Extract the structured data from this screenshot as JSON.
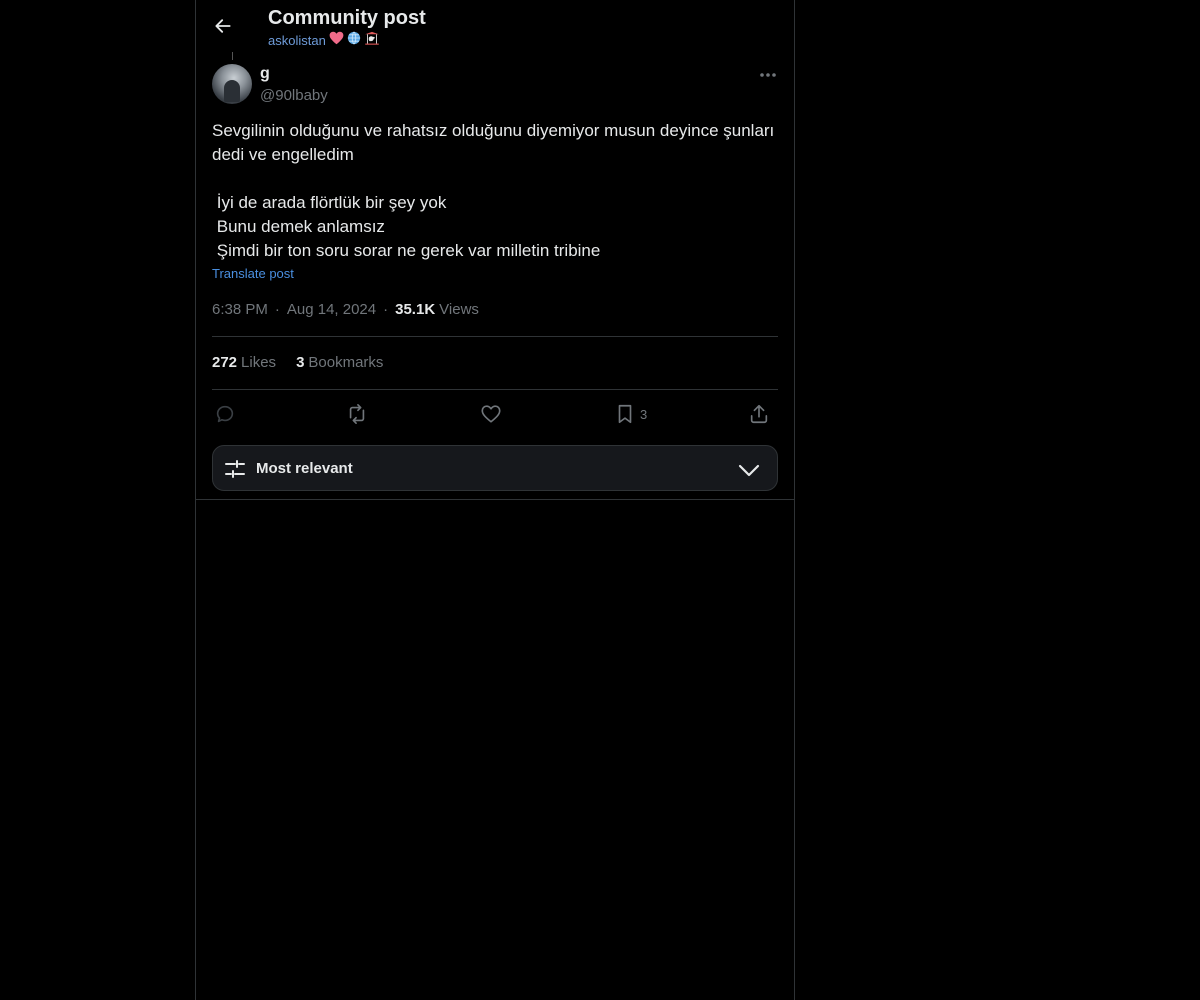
{
  "header": {
    "title": "Community post",
    "community": "askolistan",
    "community_emojis": [
      "heart-icon",
      "globe-icon",
      "carousel-horse-icon"
    ],
    "back_icon": "arrow-left-icon"
  },
  "post": {
    "author": {
      "display_name": "g",
      "handle": "@90lbaby"
    },
    "text": "Sevgilinin olduğunu ve rahatsız olduğunu diyemiyor musun deyince şunları dedi ve engelledim\n\n İyi de arada flörtlük bir şey yok\n Bunu demek anlamsız\n Şimdi bir ton soru sorar ne gerek var milletin tribine",
    "translate_label": "Translate post",
    "time": "6:38 PM",
    "separator": "·",
    "date": "Aug 14, 2024",
    "views_count": "35.1K",
    "views_label": "Views"
  },
  "stats": {
    "likes_count": "272",
    "likes_label": "Likes",
    "bookmarks_count": "3",
    "bookmarks_label": "Bookmarks"
  },
  "actions": {
    "reply_icon": "reply-icon",
    "repost_icon": "repost-icon",
    "like_icon": "heart-icon",
    "bookmark_icon": "bookmark-icon",
    "bookmark_count": "3",
    "share_icon": "share-icon"
  },
  "sort": {
    "label": "Most relevant",
    "icon": "sliders-icon",
    "chevron": "chevron-down-icon"
  },
  "colors": {
    "background": "#000000",
    "text": "#e7e9ea",
    "muted": "#71767b",
    "link": "#4a8fe0",
    "border": "#2f3336"
  }
}
